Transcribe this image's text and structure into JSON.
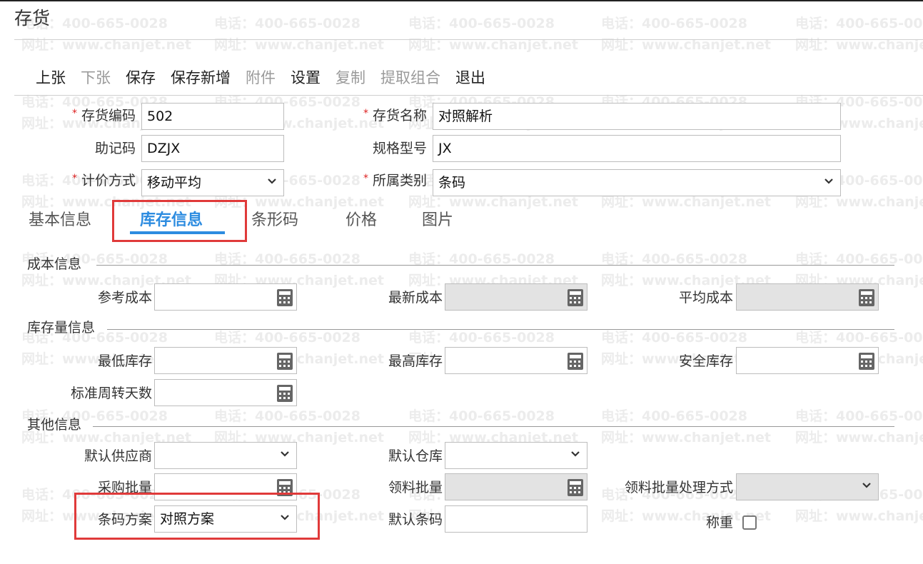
{
  "window": {
    "title": "存货"
  },
  "toolbar": {
    "items": [
      {
        "label": "上张",
        "enabled": true
      },
      {
        "label": "下张",
        "enabled": false
      },
      {
        "label": "保存",
        "enabled": true
      },
      {
        "label": "保存新增",
        "enabled": true
      },
      {
        "label": "附件",
        "enabled": false
      },
      {
        "label": "设置",
        "enabled": true
      },
      {
        "label": "复制",
        "enabled": false
      },
      {
        "label": "提取组合",
        "enabled": false
      },
      {
        "label": "退出",
        "enabled": true
      }
    ]
  },
  "header_form": {
    "code": {
      "label": "存货编码",
      "required": true,
      "value": "502"
    },
    "name": {
      "label": "存货名称",
      "required": true,
      "value": "对照解析"
    },
    "mnemonic": {
      "label": "助记码",
      "required": false,
      "value": "DZJX"
    },
    "spec": {
      "label": "规格型号",
      "required": false,
      "value": "JX"
    },
    "pricing_method": {
      "label": "计价方式",
      "required": true,
      "value": "移动平均"
    },
    "category": {
      "label": "所属类别",
      "required": true,
      "value": "条码"
    }
  },
  "tabs": [
    {
      "label": "基本信息",
      "active": false
    },
    {
      "label": "库存信息",
      "active": true
    },
    {
      "label": "条形码",
      "active": false
    },
    {
      "label": "价格",
      "active": false
    },
    {
      "label": "图片",
      "active": false
    }
  ],
  "sections": {
    "cost": {
      "title": "成本信息",
      "ref_cost": {
        "label": "参考成本",
        "value": ""
      },
      "latest_cost": {
        "label": "最新成本",
        "value": ""
      },
      "avg_cost": {
        "label": "平均成本",
        "value": ""
      }
    },
    "stock": {
      "title": "库存量信息",
      "min_stock": {
        "label": "最低库存",
        "value": ""
      },
      "max_stock": {
        "label": "最高库存",
        "value": ""
      },
      "safe_stock": {
        "label": "安全库存",
        "value": ""
      },
      "turnover_days": {
        "label": "标准周转天数",
        "value": ""
      }
    },
    "other": {
      "title": "其他信息",
      "default_supplier": {
        "label": "默认供应商",
        "value": ""
      },
      "default_warehouse": {
        "label": "默认仓库",
        "value": ""
      },
      "purchase_batch": {
        "label": "采购批量",
        "value": ""
      },
      "pick_batch": {
        "label": "领料批量",
        "value": ""
      },
      "pick_batch_method": {
        "label": "领料批量处理方式",
        "value": ""
      },
      "barcode_scheme": {
        "label": "条码方案",
        "value": "对照方案"
      },
      "default_barcode": {
        "label": "默认条码",
        "value": ""
      },
      "weighing": {
        "label": "称重",
        "checked": false
      }
    }
  },
  "watermark": {
    "phone": "电话：400-665-0028",
    "site": "网址：www.chanjet.net"
  },
  "colors": {
    "accent": "#2d8ce0",
    "highlight_box": "#e03a3a",
    "required": "#dd2222"
  }
}
